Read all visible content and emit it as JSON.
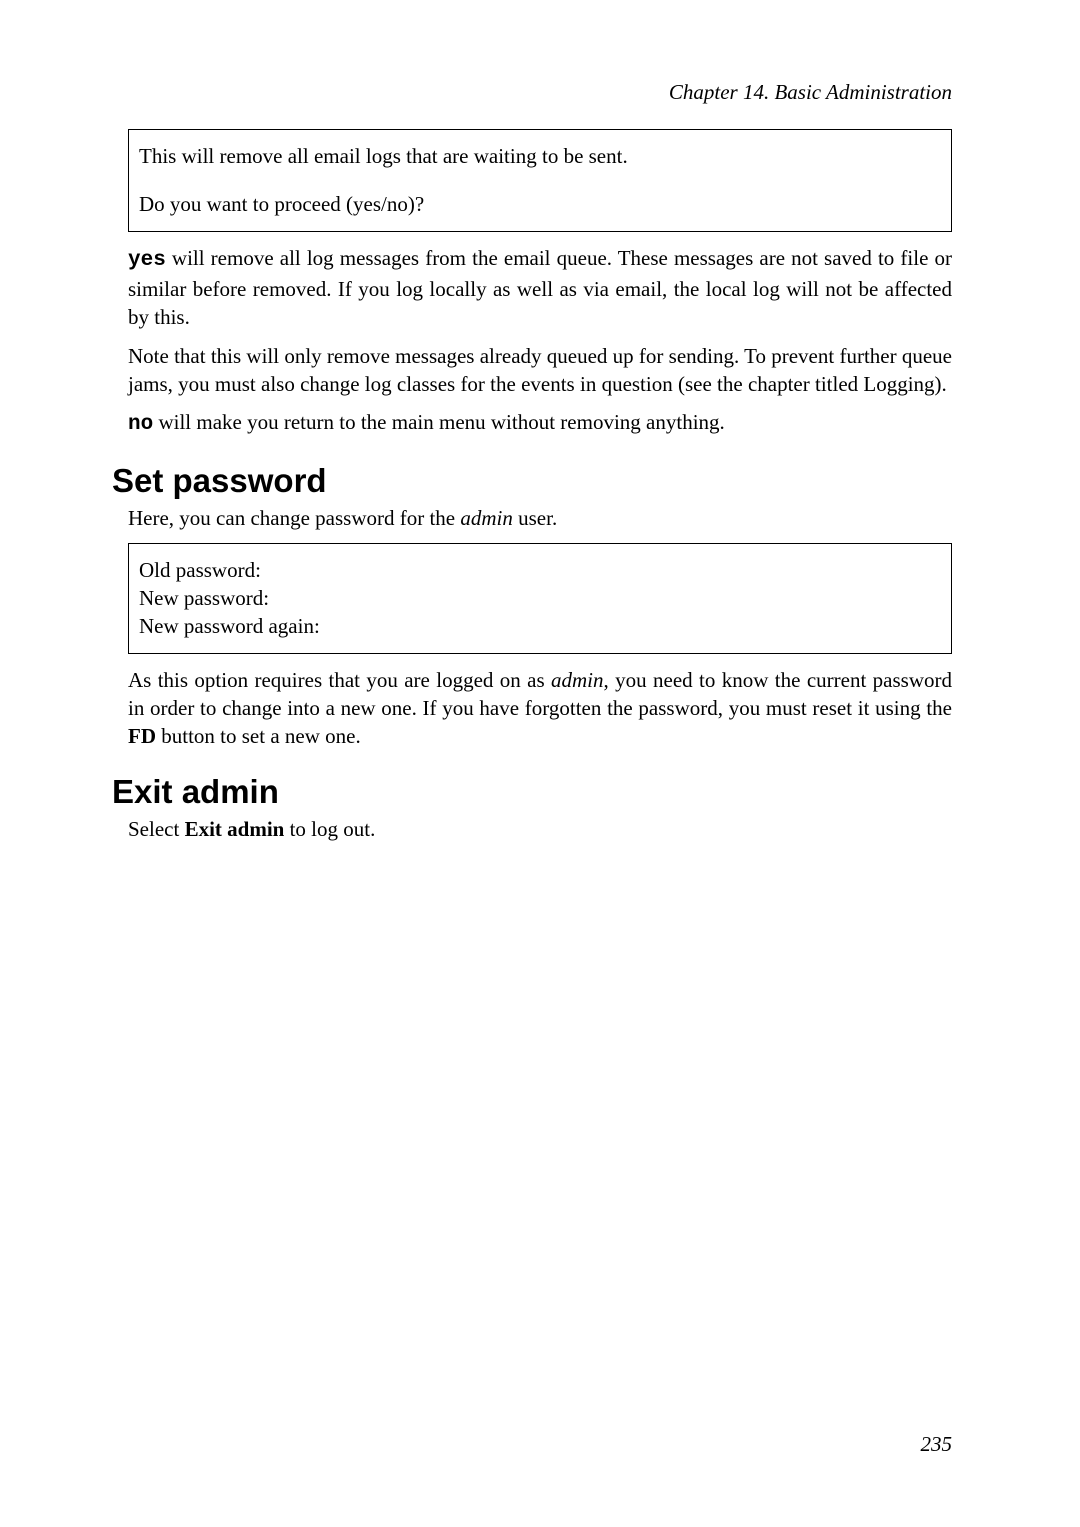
{
  "header": "Chapter 14. Basic Administration",
  "box1": {
    "line1": "This will remove all email logs that are waiting to be sent.",
    "line2": "Do you want to proceed (yes/no)?"
  },
  "para1": {
    "yes": "yes",
    "rest": " will remove all log messages from the email queue. These messages are not saved to file or similar before removed. If you log locally as well as via email, the local log will not be affected by this."
  },
  "para2": "Note that this will only remove messages already queued up for sending. To prevent further queue jams, you must also change log classes for the events in question (see the chapter titled Logging).",
  "para3": {
    "no": "no",
    "rest": " will make you return to the main menu without removing anything."
  },
  "section1": {
    "title": "Set password",
    "intro_pre": "Here, you can change password for the ",
    "intro_em": "admin",
    "intro_post": " user."
  },
  "box2": {
    "l1": "Old password:",
    "l2": "New password:",
    "l3": "New password again:"
  },
  "para4": {
    "p1": "As this option requires that you are logged on as ",
    "em": "admin",
    "p2": ", you need to know the current password in order to change into a new one. If you have forgotten the password, you must reset it using the ",
    "bold": "FD",
    "p3": " button to set a new one."
  },
  "section2": {
    "title": "Exit admin",
    "pre": "Select ",
    "bold": "Exit admin",
    "post": " to log out."
  },
  "pageNumber": "235"
}
